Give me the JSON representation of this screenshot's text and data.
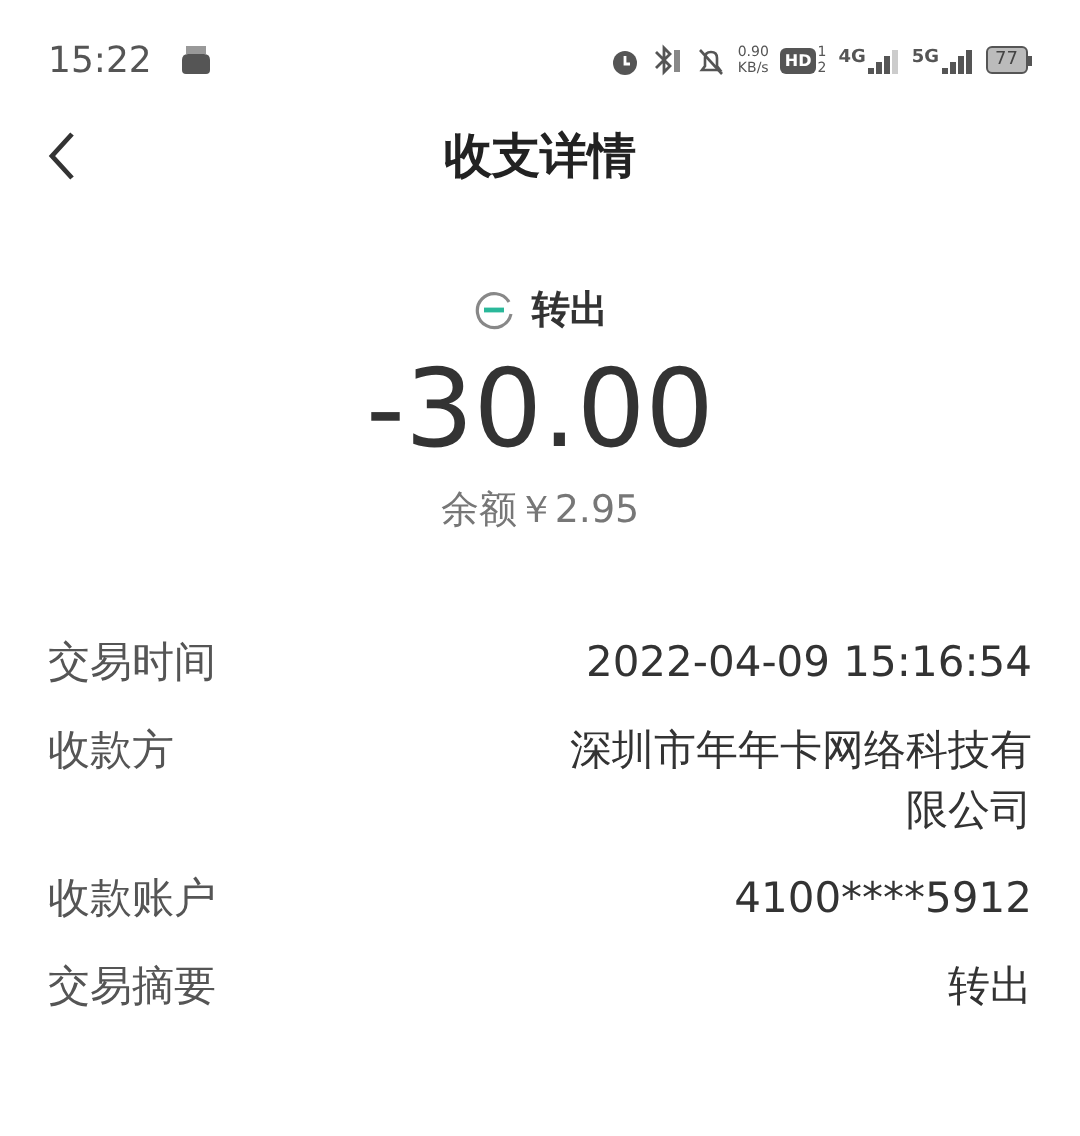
{
  "status_bar": {
    "time": "15:22",
    "speed": "0.90",
    "speed_unit": "KB/s",
    "hd": "HD",
    "hd_sims": [
      "1",
      "2"
    ],
    "network_4g": "4G",
    "network_5g": "5G",
    "battery": "77"
  },
  "header": {
    "title": "收支详情"
  },
  "summary": {
    "type": "转出",
    "amount": "-30.00",
    "balance": "余额￥2.95"
  },
  "details": [
    {
      "label": "交易时间",
      "value": "2022-04-09 15:16:54"
    },
    {
      "label": "收款方",
      "value": "深圳市年年卡网络科技有限公司"
    },
    {
      "label": "收款账户",
      "value": "4100****5912"
    },
    {
      "label": "交易摘要",
      "value": "转出"
    }
  ]
}
